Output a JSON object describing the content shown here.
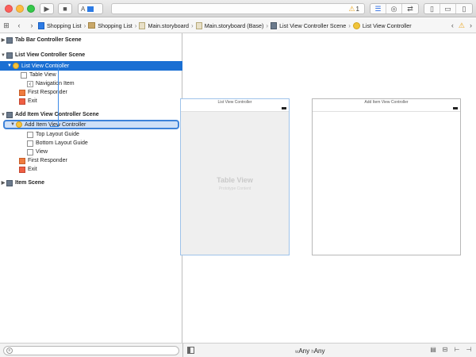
{
  "toolbar": {
    "warning_count": "1",
    "warning_icon": "warning-triangle-icon"
  },
  "breadcrumbs": [
    {
      "label": "Shopping List",
      "icon": "project-icon"
    },
    {
      "label": "Shopping List",
      "icon": "folder-icon"
    },
    {
      "label": "Main.storyboard",
      "icon": "storyboard-icon"
    },
    {
      "label": "Main.storyboard (Base)",
      "icon": "storyboard-icon"
    },
    {
      "label": "List View Controller Scene",
      "icon": "scene-icon"
    },
    {
      "label": "List View Controller",
      "icon": "view-controller-icon"
    }
  ],
  "outline": {
    "items": [
      {
        "label": "Tab Bar Controller Scene",
        "level": 0,
        "disclosure": "collapsed",
        "icon": "scene-icon",
        "bold": true
      },
      {
        "label": "List View Controller Scene",
        "level": 0,
        "disclosure": "expanded",
        "icon": "scene-icon",
        "bold": true
      },
      {
        "label": "List View Controller",
        "level": 1,
        "disclosure": "expanded",
        "icon": "view-controller-icon",
        "selected": true
      },
      {
        "label": "Table View",
        "level": 2,
        "icon": "table-view-icon"
      },
      {
        "label": "Navigation Item",
        "level": 2,
        "icon": "navigation-item-icon"
      },
      {
        "label": "First Responder",
        "level": 1,
        "icon": "first-responder-icon"
      },
      {
        "label": "Exit",
        "level": 1,
        "icon": "exit-icon"
      },
      {
        "label": "Add Item View Controller Scene",
        "level": 0,
        "disclosure": "expanded",
        "icon": "scene-icon",
        "bold": true
      },
      {
        "label": "Add Item View Controller",
        "level": 1,
        "disclosure": "expanded",
        "icon": "view-controller-icon",
        "drop_target": true
      },
      {
        "label": "Top Layout Guide",
        "level": 2,
        "icon": "layout-guide-icon"
      },
      {
        "label": "Bottom Layout Guide",
        "level": 2,
        "icon": "layout-guide-icon"
      },
      {
        "label": "View",
        "level": 2,
        "icon": "view-icon"
      },
      {
        "label": "First Responder",
        "level": 1,
        "icon": "first-responder-icon"
      },
      {
        "label": "Exit",
        "level": 1,
        "icon": "exit-icon"
      },
      {
        "label": "Item Scene",
        "level": 0,
        "disclosure": "collapsed",
        "icon": "scene-icon",
        "bold": true
      }
    ]
  },
  "canvas": {
    "scenes": [
      {
        "title": "List View Controller",
        "placeholder_title": "Table View",
        "placeholder_subtitle": "Prototype Content"
      },
      {
        "title": "Add Item View Controller"
      }
    ],
    "size_class_width_prefix": "w",
    "size_class_width": "Any",
    "size_class_height_prefix": "h",
    "size_class_height": "Any"
  },
  "colors": {
    "selection": "#1a6fd3",
    "drop_target_border": "#3e83d9",
    "connection_line": "#3b8ae6"
  }
}
